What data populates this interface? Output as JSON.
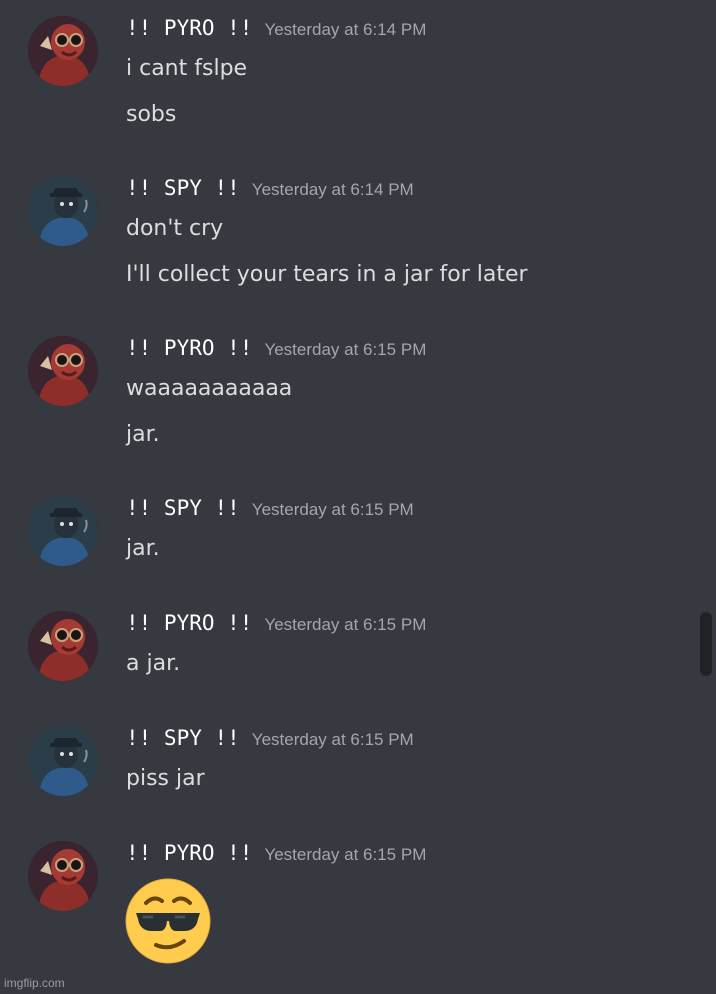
{
  "messages": [
    {
      "author": "!! PYRO !!",
      "timestamp": "Yesterday at 6:14 PM",
      "lines": [
        "i cant fslpe",
        "sobs"
      ]
    },
    {
      "author": "!! SPY !!",
      "timestamp": "Yesterday at 6:14 PM",
      "lines": [
        "don't cry",
        "I'll collect your tears in a jar for later"
      ]
    },
    {
      "author": "!! PYRO !!",
      "timestamp": "Yesterday at 6:15 PM",
      "lines": [
        "waaaaaaaaaaa",
        "jar."
      ]
    },
    {
      "author": "!! SPY !!",
      "timestamp": "Yesterday at 6:15 PM",
      "lines": [
        "jar."
      ]
    },
    {
      "author": "!! PYRO !!",
      "timestamp": "Yesterday at 6:15 PM",
      "lines": [
        "a jar."
      ]
    },
    {
      "author": "!! SPY !!",
      "timestamp": "Yesterday at 6:15 PM",
      "lines": [
        "piss jar"
      ]
    },
    {
      "author": "!! PYRO !!",
      "timestamp": "Yesterday at 6:15 PM",
      "emoji": "sunglasses-smirk-emoji"
    }
  ],
  "watermark": "imgflip.com",
  "colors": {
    "background": "#36393f",
    "username": "#ffffff",
    "timestamp": "#a3a6aa",
    "text": "#dcddde"
  }
}
